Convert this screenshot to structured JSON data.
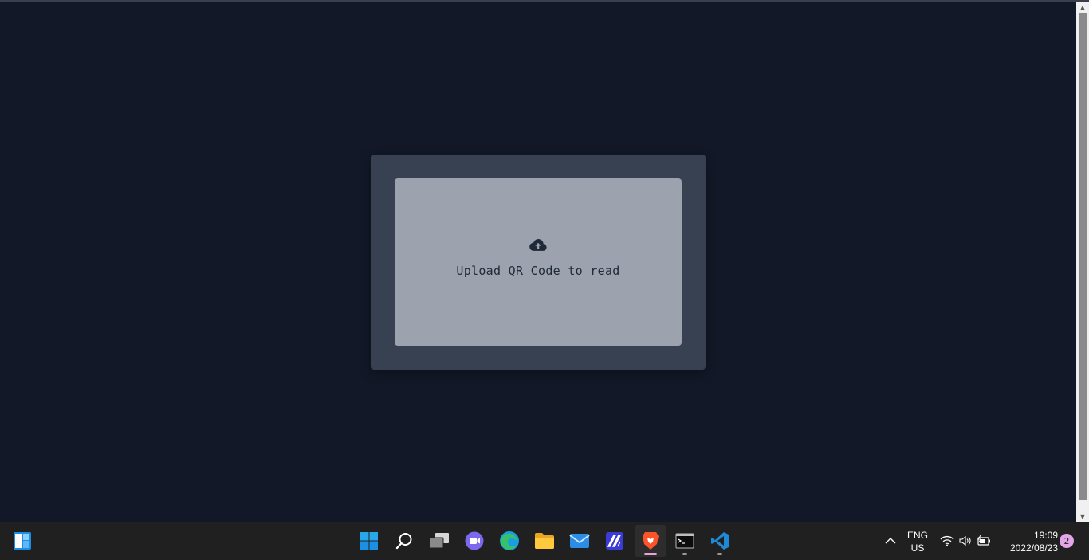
{
  "upload": {
    "label": "Upload QR Code to read",
    "icon": "cloud-upload-icon"
  },
  "taskbar": {
    "widgets_icon": "widgets-icon",
    "apps": [
      {
        "name": "start",
        "icon": "windows-logo-icon"
      },
      {
        "name": "search",
        "icon": "search-icon"
      },
      {
        "name": "task-view",
        "icon": "task-view-icon"
      },
      {
        "name": "teams-chat",
        "icon": "chat-icon"
      },
      {
        "name": "edge",
        "icon": "edge-icon"
      },
      {
        "name": "file-explorer",
        "icon": "folder-icon"
      },
      {
        "name": "mail",
        "icon": "mail-icon"
      },
      {
        "name": "app",
        "icon": "app-icon"
      },
      {
        "name": "brave",
        "icon": "brave-lion-icon"
      },
      {
        "name": "terminal",
        "icon": "terminal-icon"
      },
      {
        "name": "vscode",
        "icon": "vscode-icon"
      }
    ],
    "tray": {
      "language_line1": "ENG",
      "language_line2": "US",
      "time": "19:09",
      "date": "2022/08/23",
      "notification_count": "2"
    }
  },
  "colors": {
    "page_bg": "#121827",
    "card_bg": "#374151",
    "dropzone_bg": "#9ca3af",
    "taskbar_bg": "#202020",
    "brave_accent": "#fb542b",
    "vscode_accent": "#1e8ad6"
  }
}
